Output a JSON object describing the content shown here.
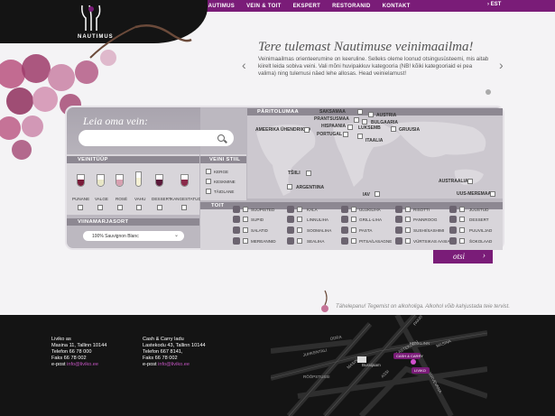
{
  "nav": {
    "items": [
      "NAUTIMUS",
      "VEIN & TOIT",
      "EKSPERT",
      "RESTORANID",
      "KONTAKT"
    ],
    "lang": "› EST"
  },
  "logo": {
    "text": "NAUTIMUS"
  },
  "hero": {
    "title": "Tere tulemast Nautimuse veinimaailma!",
    "text": "Veinimaailmas orienteerumine on keeruline. Selleks oleme loonud otsingusüsteemi, mis aitab kiirelt leida sobiva veini. Vali mõni huvipakkuv kategooria (NB! kõiki kategooriaid ei pea valima) ning tulemusi näed lehe allosas. Head veinielamust!",
    "prev": "‹",
    "next": "›"
  },
  "search": {
    "title": "Leia oma vein:",
    "placeholder": ""
  },
  "wine_type": {
    "label": "VEINITÜÜP",
    "items": [
      "PUNANE",
      "VALGE",
      "ROSÉ",
      "VAHU",
      "DESSERT",
      "KANGESTATUD"
    ]
  },
  "wine_style": {
    "label": "VEINI STIIL",
    "items": [
      "KERGE",
      "KESKMINE",
      "TÄIDLANE"
    ]
  },
  "grape": {
    "label": "VIINAMARJASORT",
    "selected": "100% Sauvignon Blanc",
    "chev": "⌄"
  },
  "origin": {
    "label": "PÄRITOLUMAA",
    "countries": [
      "SAKSAMAA",
      "PRANTSUSMAA",
      "AUSTRIA",
      "BULGAARIA",
      "HISPAANIA",
      "LUKSEMB",
      "GRUUSIA",
      "PORTUGAL",
      "ITAALIA",
      "AMEERIKA ÜHENDRIIGID",
      "TŠIILI",
      "ARGENTIINA",
      "IAV",
      "AUSTRAALIA",
      "UUS-MEREMAA"
    ]
  },
  "food": {
    "label": "TOIT",
    "items": [
      "SUUPISTED",
      "KALA",
      "ULUKILIHA",
      "RISOTTI",
      "JUUSTUD",
      "SUPID",
      "LINNULIHA",
      "GRILL-LIHA",
      "PANNROOG",
      "DESSERT",
      "SALATID",
      "SOOMALIHA",
      "PASTA",
      "SUSHI/SASHIMI",
      "PUUVILJAD",
      "MEREANNID",
      "SEALIHA",
      "PITSA/LASAGNE",
      "VÜRTSIKAS AASIA",
      "ŠOKOLAAD"
    ]
  },
  "action": {
    "search_label": "otsi",
    "chev": "›"
  },
  "disclaimer": "Tähelepanu! Tegemist on alkoholiga. Alkohol võib kahjustada teie tervist.",
  "footer": {
    "store1": {
      "name": "Liviko as",
      "address": "Masina 11, Tallinn 10144",
      "phone": "Telefon 66 78 000",
      "fax": "Faks 66 78 002",
      "email_prefix": "e-post ",
      "email": "info@liviko.ee"
    },
    "store2": {
      "name": "Cash & Carry ladu",
      "address": "Lastekodu 43, Tallinn 10144",
      "phone": "Telefon 667 8141,",
      "fax": "Faks 66 78 002",
      "email_prefix": "e-post ",
      "email": "info@liviko.ee"
    },
    "map_labels": [
      "CASH & CARRY",
      "LIVIKO",
      "Bussijaam",
      "LASTEKODU",
      "ODRA",
      "KESKLINN",
      "JÄRVEVANA",
      "MASINA",
      "ASSI",
      "PAKRI",
      "JUHKENTALI",
      "RÖÖPSTUSSI",
      "MASINA"
    ]
  },
  "colors": {
    "brand": "#7a1c78",
    "footer_bg": "#141414",
    "panel": "#bcb8c0"
  }
}
